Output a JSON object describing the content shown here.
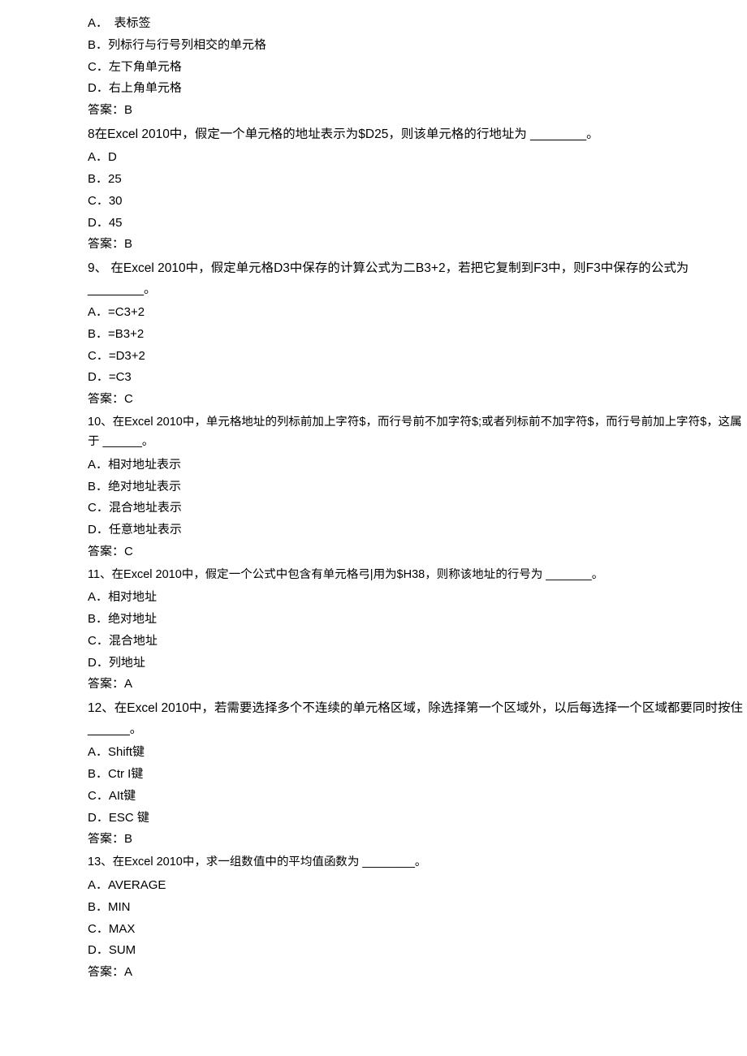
{
  "q7": {
    "optA": "A．　表标签",
    "optB": "B．列标行与行号列相交的单元格",
    "optC": "C．左下角单元格",
    "optD": "D．右上角单元格",
    "answer": "答案：B"
  },
  "q8": {
    "stem": "8在Excel 2010中，假定一个单元格的地址表示为$D25，则该单元格的行地址为 ________。",
    "optA": "A．D",
    "optB": "B．25",
    "optC": "C．30",
    "optD": "D．45",
    "answer": "答案：B"
  },
  "q9": {
    "stem": "9、 在Excel 2010中，假定单元格D3中保存的计算公式为二B3+2，若把它复制到F3中，则F3中保存的公式为________。",
    "optA": "A．=C3+2",
    "optB": "B．=B3+2",
    "optC": "C．=D3+2",
    "optD": "D．=C3",
    "answer": "答案：C"
  },
  "q10": {
    "stem": "10、在Excel 2010中，单元格地址的列标前加上字符$，而行号前不加字符$;或者列标前不加字符$，而行号前加上字符$，这属于 ______。",
    "optA": "A．相对地址表示",
    "optB": "B．绝对地址表示",
    "optC": "C．混合地址表示",
    "optD": "D．任意地址表示",
    "answer": "答案：C"
  },
  "q11": {
    "stem": "11、在Excel 2010中，假定一个公式中包含有单元格弓|用为$H38，则称该地址的行号为 _______。",
    "optA": "A．相对地址",
    "optB": "B．绝对地址",
    "optC": "C．混合地址",
    "optD": "D．列地址",
    "answer": "答案：A"
  },
  "q12": {
    "stem": "12、在Excel 2010中，若需要选择多个不连续的单元格区域，除选择第一个区域外，以后每选择一个区域都要同时按住 ______。",
    "optA": "A．Shift键",
    "optB": "B．Ctr I键",
    "optC": "C．AIt键",
    "optD": "D．ESC 键",
    "answer": "答案：B"
  },
  "q13": {
    "stem": "13、在Excel 2010中，求一组数值中的平均值函数为 ________。",
    "optA": "A．AVERAGE",
    "optB": "B．MIN",
    "optC": "C．MAX",
    "optD": "D．SUM",
    "answer": "答案：A"
  }
}
